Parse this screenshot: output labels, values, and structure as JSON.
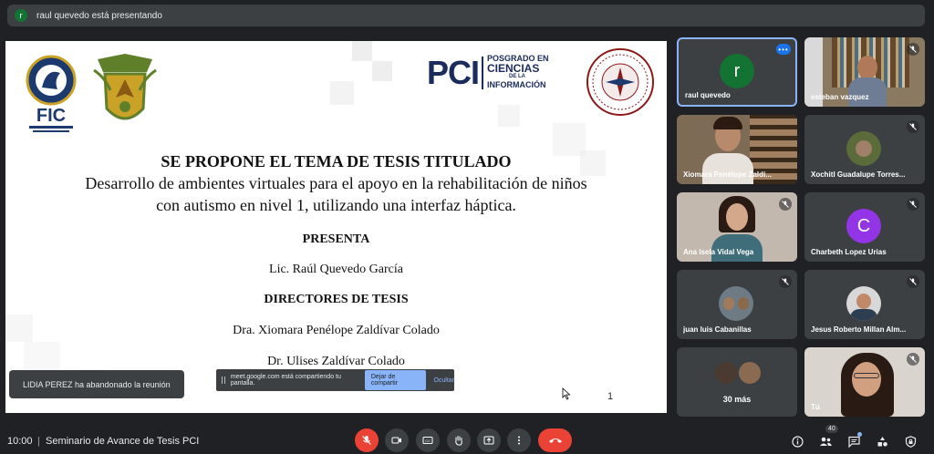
{
  "presenting_banner": {
    "avatar_letter": "r",
    "text": "raul quevedo está presentando"
  },
  "slide": {
    "pci_logo": {
      "big": "PCI",
      "line1": "POSGRADO EN",
      "line2": "CIENCIAS",
      "line3": "DE LA",
      "line4": "INFORMACIÓN"
    },
    "fic_logo": "FIC",
    "heading": "SE PROPONE EL TEMA DE TESIS TITULADO",
    "title_line1": "Desarrollo de ambientes virtuales para el apoyo en la rehabilitación de niños",
    "title_line2": "con autismo en nivel 1, utilizando una interfaz háptica.",
    "presenta_label": "PRESENTA",
    "presenter": "Lic. Raúl Quevedo García",
    "directors_label": "DIRECTORES DE TESIS",
    "director1": "Dra. Xiomara Penélope Zaldívar Colado",
    "director2": "Dr. Ulises Zaldívar Colado",
    "page_number": "1"
  },
  "toast": {
    "text": "LIDIA PEREZ ha abandonado la reunión"
  },
  "share_bar": {
    "text": "meet.google.com está compartiendo tu pantalla.",
    "stop_label": "Dejar de compartir",
    "hide_label": "Ocultar"
  },
  "participants": [
    {
      "name": "raul quevedo",
      "avatar_letter": "r",
      "avatar_color": "#137333",
      "type": "avatar",
      "active": true
    },
    {
      "name": "esteban vazquez",
      "type": "video",
      "muted": true
    },
    {
      "name": "Xiomara Penélope Zaldí...",
      "type": "video",
      "muted": false
    },
    {
      "name": "Xochitl Guadalupe Torres...",
      "type": "photo",
      "muted": true
    },
    {
      "name": "Ana Isela Vidal Vega",
      "type": "video",
      "muted": true
    },
    {
      "name": "Charbeth Lopez Urias",
      "avatar_letter": "C",
      "avatar_color": "#9334e6",
      "type": "avatar",
      "muted": true
    },
    {
      "name": "juan luis Cabanillas",
      "type": "photo",
      "muted": true
    },
    {
      "name": "Jesus Roberto Millan Alm...",
      "type": "photo",
      "muted": true
    },
    {
      "name": "30 más",
      "type": "group"
    },
    {
      "name": "Tú",
      "type": "video",
      "muted": true
    }
  ],
  "bottom_bar": {
    "time": "10:00",
    "separator": "|",
    "meeting_title": "Seminario de Avance de Tesis PCI",
    "people_count": "40"
  },
  "colors": {
    "bg": "#202124",
    "tile": "#3c4043",
    "red": "#ea4335",
    "accent": "#8ab4f8"
  }
}
